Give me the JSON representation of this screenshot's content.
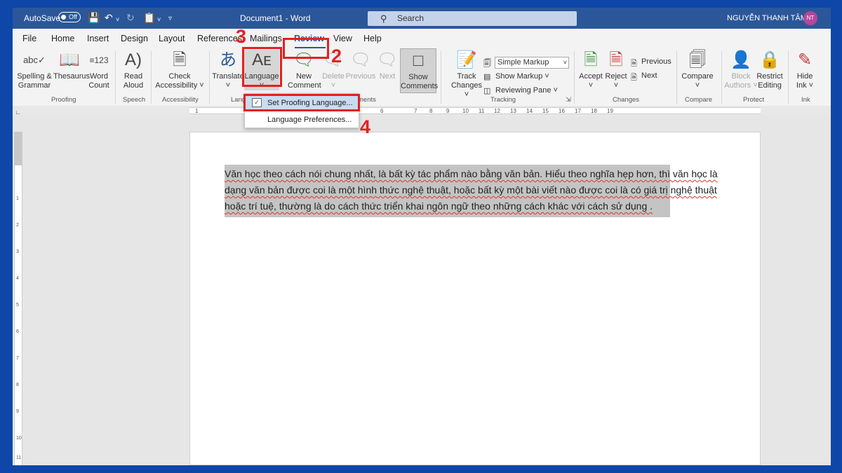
{
  "title_bar": {
    "autosave_label": "AutoSave",
    "autosave_state": "Off",
    "document_title": "Document1 - Word",
    "search_placeholder": "Search",
    "user_name": "NGUYỄN THANH TÂM",
    "user_initials": "NT"
  },
  "menu_tabs": [
    "File",
    "Home",
    "Insert",
    "Design",
    "Layout",
    "References",
    "Mailings",
    "Review",
    "View",
    "Help"
  ],
  "active_tab": "Review",
  "ribbon": {
    "proofing": {
      "spelling": "Spelling &",
      "spelling2": "Grammar",
      "thesaurus": "Thesaurus",
      "word_count": "Word",
      "word_count2": "Count",
      "label": "Proofing"
    },
    "speech": {
      "read_aloud": "Read",
      "read_aloud2": "Aloud",
      "label": "Speech"
    },
    "accessibility": {
      "check": "Check",
      "check2": "Accessibility ˅",
      "label": "Accessibility"
    },
    "language": {
      "translate": "Translate",
      "language": "Language",
      "label": "Lang"
    },
    "comments": {
      "new": "New",
      "new2": "Comment",
      "delete": "Delete",
      "previous": "Previous",
      "next": "Next",
      "show": "Show",
      "show2": "Comments",
      "label": "ments"
    },
    "tracking": {
      "track": "Track",
      "track2": "Changes ˅",
      "markup_select": "Simple Markup",
      "show_markup": "Show Markup ˅",
      "reviewing_pane": "Reviewing Pane ˅",
      "label": "Tracking"
    },
    "changes": {
      "accept": "Accept",
      "reject": "Reject",
      "previous": "Previous",
      "next": "Next",
      "label": "Changes"
    },
    "compare": {
      "compare": "Compare",
      "label": "Compare"
    },
    "protect": {
      "block": "Block",
      "block2": "Authors ˅",
      "restrict": "Restrict",
      "restrict2": "Editing",
      "label": "Protect"
    },
    "ink": {
      "hide": "Hide",
      "hide2": "Ink ˅",
      "label": "Ink"
    }
  },
  "language_menu": {
    "items": [
      "Set Proofing Language...",
      "Language Preferences..."
    ]
  },
  "ruler_numbers": [
    "1",
    "1",
    "2",
    "3",
    "4",
    "5",
    "6",
    "7",
    "8",
    "9",
    "10",
    "11",
    "12",
    "13",
    "14",
    "15",
    "16",
    "17",
    "18",
    "19"
  ],
  "vruler_numbers": [
    "1",
    "2",
    "3",
    "4",
    "5",
    "6",
    "7",
    "8",
    "9",
    "10",
    "11"
  ],
  "document": {
    "text": "Văn học theo cách nói chung nhất, là bất kỳ tác phẩm nào bằng văn bản. Hiểu theo nghĩa hẹp hơn, thì văn học là dạng văn bản được coi là một hình thức nghệ thuật, hoặc bất kỳ một bài viết nào được coi là có giá trị nghệ thuật hoặc trí tuệ, thường là do cách thức triển khai ngôn ngữ theo những cách khác với cách sử dụng ."
  },
  "annotations": {
    "step2": "2",
    "step3": "3",
    "step4": "4"
  },
  "colors": {
    "title_bar": "#2b579a",
    "annotation": "#e52020",
    "selection": "#c4c4c4",
    "frame": "#0e47a8"
  }
}
